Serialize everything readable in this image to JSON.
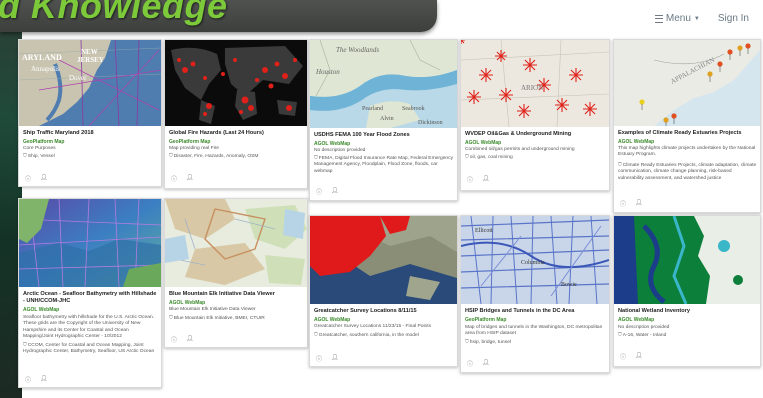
{
  "banner": {
    "title": "d Knowledge"
  },
  "nav": {
    "menu_label": "Menu",
    "signin_label": "Sign In"
  },
  "icons": {
    "info": "info-icon",
    "user": "user-icon",
    "tag": "tag-icon"
  },
  "cards": [
    {
      "title": "Ship Traffic Maryland 2018",
      "type": "GeoPlatform Map",
      "desc": "Core Purposes",
      "tags": "Ship, Vessel"
    },
    {
      "title": "Global Fire Hazards (Last 24 Hours)",
      "type": "GeoPlatform Map",
      "desc": "Map providing real Fire",
      "tags": "Disaster, Fire, Hazards, Anomaly, OSM"
    },
    {
      "title": "USDHS FEMA 100 Year Flood Zones",
      "type": "AGOL WebMap",
      "desc": "No description provided",
      "tags": "FEMA, Digital Flood Insurance Rate Map, Federal Emergency Management Agency, Floodplain, Flood Zone, floods, car webmap"
    },
    {
      "title": "WVDEP Oil&Gas & Underground Mining",
      "type": "AGOL WebMap",
      "desc": "Combined oil/gas permits and underground mining",
      "tags": "oil, gas, coal mining"
    },
    {
      "title": "Examples of Climate Ready Estuaries Projects",
      "type": "AGOL WebMap",
      "desc": "This map highlights climate projects undertaken by the National Estuary Program.",
      "tags": "Climate Ready Estuaries Projects, climate adaptation, climate communication, climate change planning, risk-based vulnerability assessment, and watershed justice"
    },
    {
      "title": "Arctic Ocean - Seafloor Bathymetry with Hillshade - UNH/CCOM-JHC",
      "type": "AGOL WebMap",
      "desc": "Seafloor bathymetry with hillshade for the U.S. Arctic Ocean. These grids are the Copyright of the University of New Hampshire and its Center for Coastal and Ocean Mapping/Joint Hydrographic Center - 10/2012",
      "tags": "CCOM, Center for Coastal and Ocean Mapping, Joint Hydrographic Center, Bathymetry, Seafloor, US Arctic Ocean"
    },
    {
      "title": "Blue Mountain Elk Initiative Data Viewer",
      "type": "AGOL WebMap",
      "desc": "Blue Mountain Elk Initiative Data Viewer",
      "tags": "Blue Mountain Elk Initiative, BMEI, CTUIR"
    },
    {
      "title": "Greatcatcher Survey Locations 8/11/15",
      "type": "AGOL WebMap",
      "desc": "Greatcatcher Survey Locations 11/23/15 - Final Points",
      "tags": "Greatcatcher, southern california, in the model"
    },
    {
      "title": "HSIP Bridges and Tunnels in the DC Area",
      "type": "GeoPlatform Map",
      "desc": "Map of bridges and tunnels in the Washington, DC metropolitan area from HSIP dataset",
      "tags": "hsip, bridge, tunnel"
    },
    {
      "title": "National Wetland Inventory",
      "type": "AGOL WebMap",
      "desc": "No description provided",
      "tags": "A-16, Water - Inland"
    }
  ],
  "colors": {
    "accent_green": "#3a8a2a",
    "banner_green": "#7cc93a"
  }
}
